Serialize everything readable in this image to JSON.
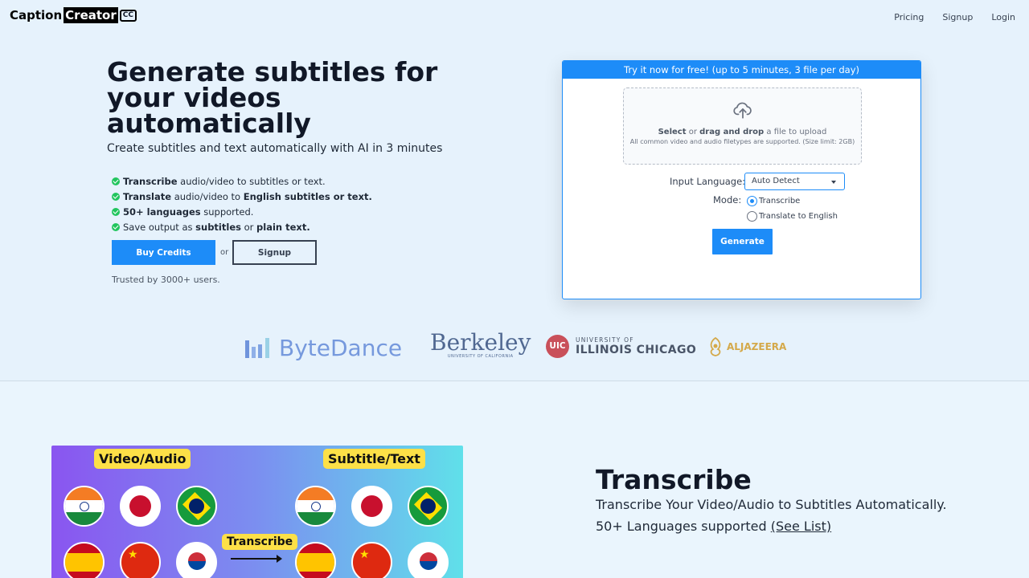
{
  "nav": {
    "logo_part1": "Caption",
    "logo_part2": "Creator",
    "logo_badge": "CC",
    "links": [
      "Pricing",
      "Signup",
      "Login"
    ]
  },
  "hero": {
    "title": "Generate subtitles for your videos automatically",
    "subtitle": "Create subtitles and text automatically with AI in 3 minutes",
    "features": [
      {
        "bold1": "Transcribe",
        "text1": " audio/video to subtitles or text.",
        "bold2": "",
        "text2": ""
      },
      {
        "bold1": "Translate",
        "text1": " audio/video to ",
        "bold2": "English subtitles or text.",
        "text2": ""
      },
      {
        "bold1": "50+ languages",
        "text1": " supported.",
        "bold2": "",
        "text2": ""
      },
      {
        "bold1": "",
        "text1": "Save output as ",
        "bold2": "subtitles",
        "text2": " or ",
        "bold3": "plain text."
      }
    ],
    "buy_label": "Buy Credits",
    "or_label": "or",
    "signup_label": "Signup",
    "trusted": "Trusted by 3000+ users."
  },
  "upload": {
    "header": "Try it now for free! (up to 5 minutes, 3 file per day)",
    "select": "Select",
    "or": " or ",
    "drag": "drag and drop",
    "tail": " a file to upload",
    "note": "All common video and audio filetypes are supported. (Size limit: 2GB)",
    "input_language_label": "Input Language:",
    "input_language_value": "Auto Detect",
    "mode_label": "Mode:",
    "mode_options": [
      "Transcribe",
      "Translate to English"
    ],
    "mode_selected": 0,
    "generate_label": "Generate"
  },
  "logos": {
    "bytedance": "ByteDance",
    "berkeley": "Berkeley",
    "berkeley_sub": "UNIVERSITY OF CALIFORNIA",
    "uic_badge": "UIC",
    "uic_line1": "UNIVERSITY OF",
    "uic_line2": "ILLINOIS CHICAGO",
    "aljazeera": "ALJAZEERA"
  },
  "section": {
    "illus_left_tag": "Video/Audio",
    "illus_right_tag": "Subtitle/Text",
    "illus_mid_tag": "Transcribe",
    "title": "Transcribe",
    "subtitle": "Transcribe Your Video/Audio to Subtitles Automatically.",
    "languages": "50+ Languages supported ",
    "see_list": "(See List)"
  },
  "colors": {
    "accent": "#1d8cf8",
    "success": "#22c55e",
    "background": "#e6f2fc"
  }
}
